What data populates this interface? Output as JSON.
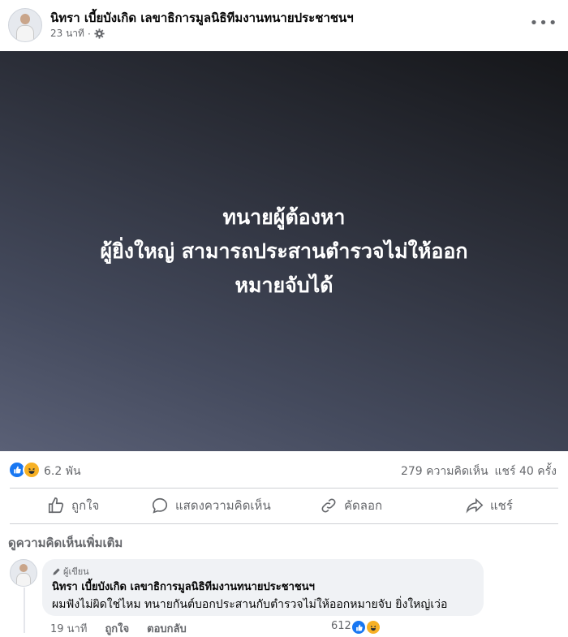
{
  "post": {
    "author": "นิทรา เบี้ยบังเกิด เลขาธิการมูลนิธิทีมงานทนายประชาชนฯ",
    "time": "23 นาที",
    "privacy_icon": "gear-icon",
    "image_text": [
      "ทนายผู้ต้องหา",
      "ผู้ยิ่งใหญ่ สามารถประสานตำรวจไม่ให้ออก",
      "หมายจับได้"
    ]
  },
  "stats": {
    "reactions_count": "6.2 พัน",
    "comments": "279 ความคิดเห็น",
    "shares": "แชร์ 40 ครั้ง"
  },
  "actions": {
    "like": "ถูกใจ",
    "comment": "แสดงความคิดเห็น",
    "copy": "คัดลอก",
    "share": "แชร์"
  },
  "comments_section": {
    "more_comments": "ดูความคิดเห็นเพิ่มเติม",
    "comment": {
      "badge": "ผู้เขียน",
      "author": "นิทรา เบี้ยบังเกิด เลขาธิการมูลนิธิทีมงานทนายประชาชนฯ",
      "text": "ผมฟังไม่ผิดใช่ไหม ทนายกันต์บอกประสานกับตำรวจไม่ให้ออกหมายจับ ยิ่งใหญ่เว่อ",
      "time": "19 นาที",
      "like": "ถูกใจ",
      "reply": "ตอบกลับ",
      "reactions_count": "612"
    }
  },
  "colors": {
    "brand": "#1877f2",
    "muted": "#65676b",
    "haha": "#f7b125"
  }
}
